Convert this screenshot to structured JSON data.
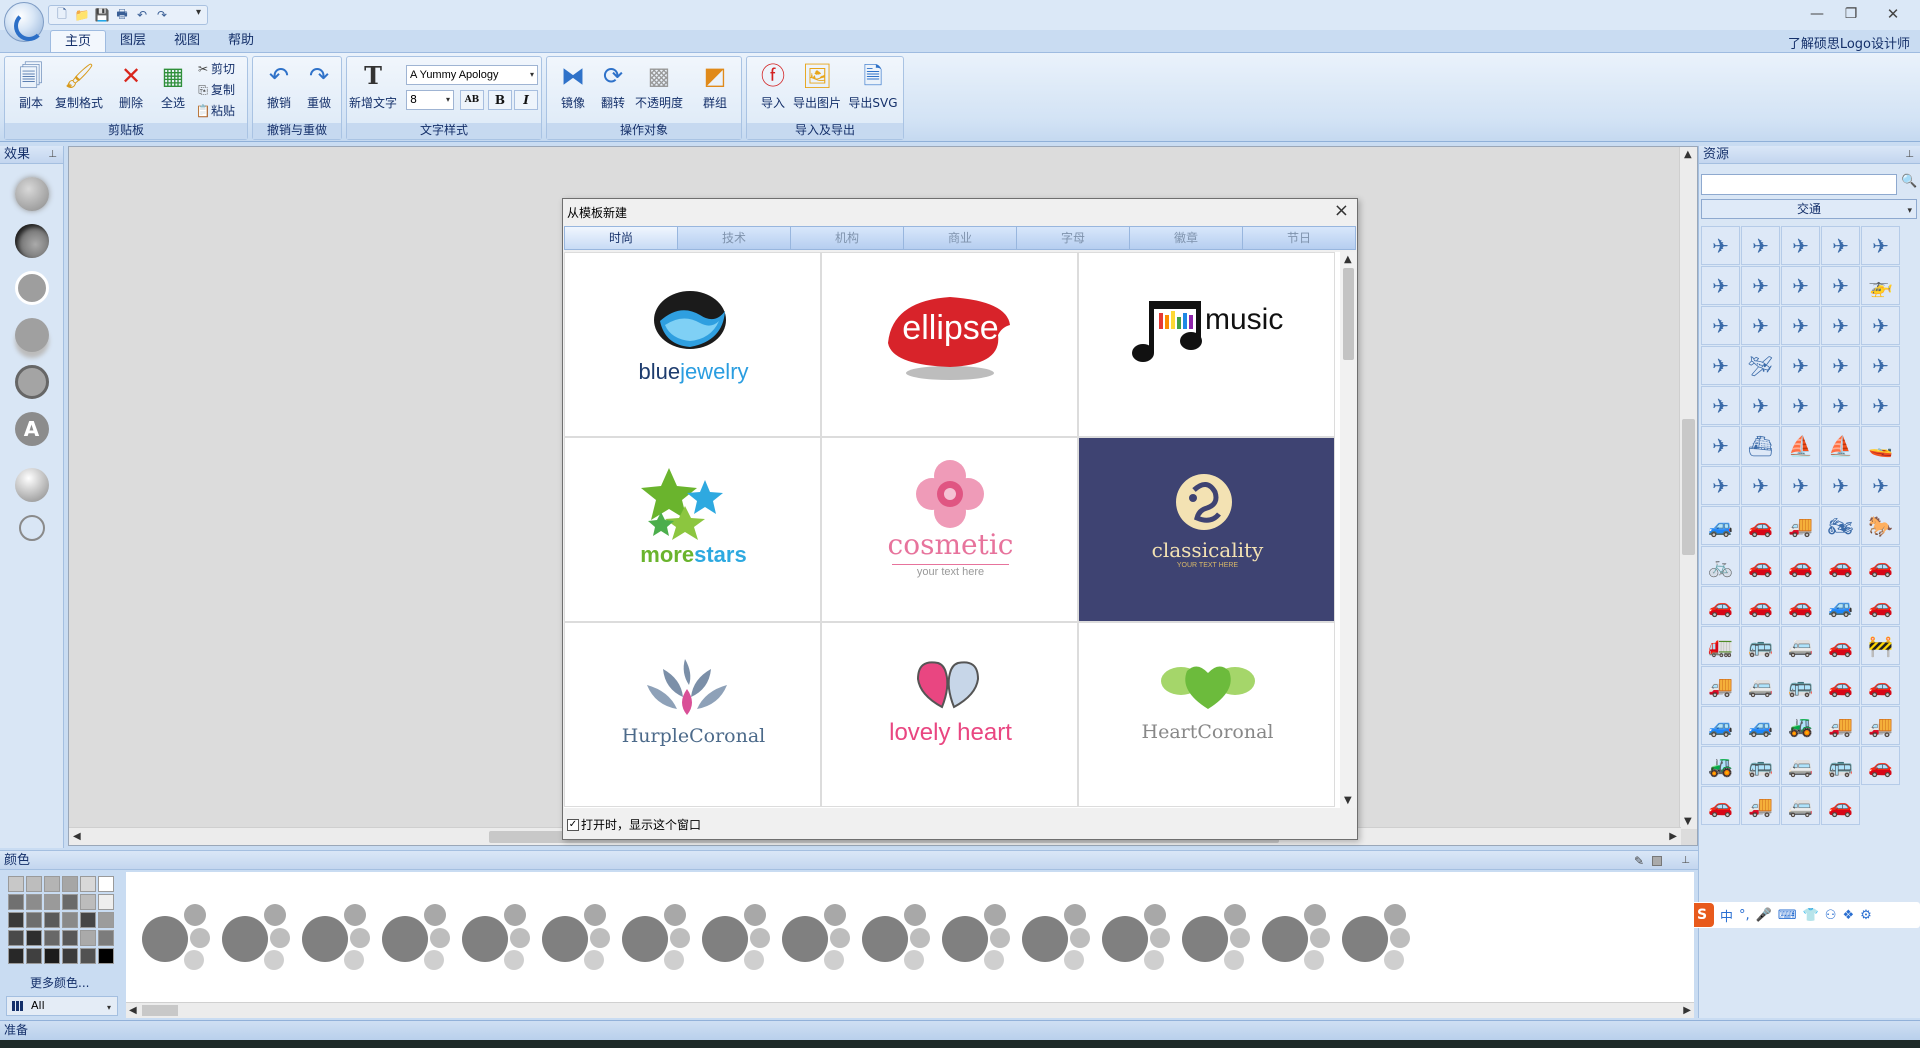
{
  "quick_access": {
    "items": [
      "new-icon",
      "open-icon",
      "save-icon",
      "print-icon",
      "undo-icon",
      "redo-icon"
    ]
  },
  "window": {
    "min": "—",
    "max": "❐",
    "close": "✕"
  },
  "brand_link": "了解硕思Logo设计师",
  "tabs": [
    "主页",
    "图层",
    "视图",
    "帮助"
  ],
  "ribbon": {
    "clipboard": {
      "label": "剪贴板",
      "copy_page": "副本",
      "format_painter": "复制格式",
      "delete": "删除",
      "select_all": "全选",
      "cut": "剪切",
      "copy": "复制",
      "paste": "粘贴"
    },
    "undo_group": {
      "label": "撤销与重做",
      "undo": "撤销",
      "redo": "重做"
    },
    "text_style": {
      "label": "文字样式",
      "new_text": "新增文字",
      "font": "A Yummy Apology",
      "size": "8",
      "bold": "B",
      "italic": "I",
      "ab": "AB"
    },
    "objects": {
      "label": "操作对象",
      "mirror": "镜像",
      "flip": "翻转",
      "opacity": "不透明度",
      "group": "群组"
    },
    "io": {
      "label": "导入及导出",
      "import": "导入",
      "export_image": "导出图片",
      "export_svg": "导出SVG"
    }
  },
  "effects_panel": {
    "title": "效果"
  },
  "dialog": {
    "title": "从模板新建",
    "tabs": [
      "时尚",
      "技术",
      "机构",
      "商业",
      "字母",
      "徽章",
      "节日"
    ],
    "templates": {
      "blue_text1": "blue",
      "blue_text2": "jewelry",
      "ellipse": "ellipse",
      "music": "music",
      "more_text1": "more",
      "more_text2": "stars",
      "cosmetic": "cosmetic",
      "cosmetic_sub": "your text here",
      "classicality": "classicality",
      "classicality_sub": "YOUR TEXT HERE",
      "hurple": "HurpleCoronal",
      "lovely": "lovely heart",
      "heart": "HeartCoronal"
    },
    "show_on_open": "打开时，显示这个窗口",
    "checked": "✓"
  },
  "resources_panel": {
    "title": "资源",
    "category": "交通",
    "search_value": ""
  },
  "ime": {
    "logo": "S",
    "items": [
      "中",
      "°,",
      "🎤",
      "⌨",
      "👕",
      "⚇",
      "❖",
      "⚙"
    ]
  },
  "colors_panel": {
    "title": "颜色",
    "more_colors": "更多颜色...",
    "filter": "All"
  },
  "status": "准备",
  "colors": {
    "swatches": [
      "#c8c8c8",
      "#bdbdbd",
      "#b4b4b4",
      "#a6a6a6",
      "#d8d8d8",
      "#ffffff",
      "#707070",
      "#8c8c8c",
      "#9a9a9a",
      "#6a6a6a",
      "#bcbcbc",
      "#eeeeee",
      "#3a3a3a",
      "#6e6e6e",
      "#5a5a5a",
      "#8a8a8a",
      "#464646",
      "#9c9c9c",
      "#4a4a4a",
      "#2e2e2e",
      "#686868",
      "#585858",
      "#aaaaaa",
      "#7c7c7c",
      "#282828",
      "#404040",
      "#1c1c1c",
      "#3c3c3c",
      "#525252",
      "#000000"
    ],
    "dialog_dark": "#3e4372"
  }
}
